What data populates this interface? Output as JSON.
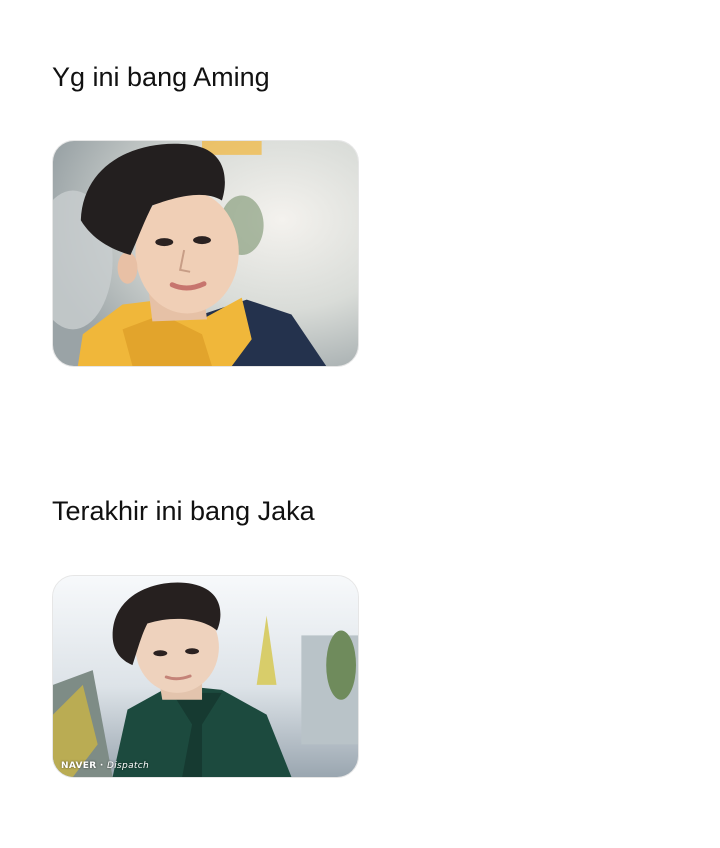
{
  "posts": [
    {
      "caption": "Yg ini bang Aming",
      "image": {
        "subject": "young man with dark hair in yellow hoodie and navy jacket, blurred outdoor background"
      }
    },
    {
      "caption": "Terakhir ini bang Jaka",
      "image": {
        "subject": "young man with dark hair in dark green jacket, bright outdoor background with plants",
        "watermark_naver": "NAVER",
        "watermark_dispatch": "Dispatch"
      }
    }
  ]
}
